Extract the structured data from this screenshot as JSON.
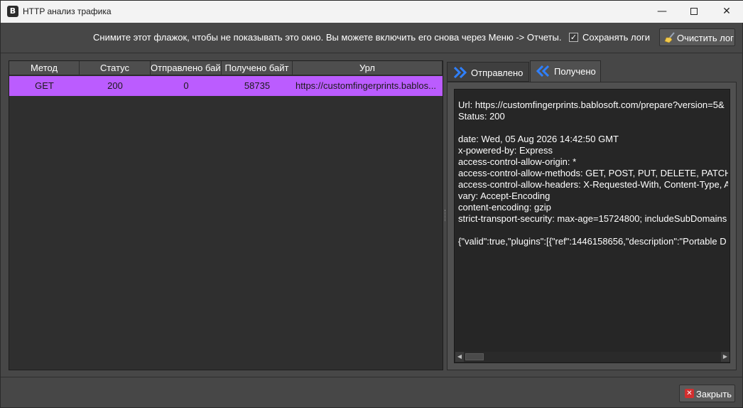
{
  "window": {
    "title": "HTTP анализ трафика",
    "app_icon_letter": "B",
    "minimize_glyph": "—",
    "close_glyph": "✕"
  },
  "toolbar": {
    "info_text": "Снимите этот флажок, чтобы не показывать это окно. Вы можете включить его снова через Меню -> Отчеты.",
    "save_logs_checked": true,
    "save_logs_check_glyph": "✓",
    "save_logs_label": "Сохранять логи",
    "clear_log_label": "Очистить лог",
    "clear_log_icon": "broom-icon"
  },
  "table": {
    "columns": [
      "Метод",
      "Статус",
      "Отправлено байт",
      "Получено байт",
      "Урл"
    ],
    "rows": [
      {
        "method": "GET",
        "status": "200",
        "sent": "0",
        "received": "58735",
        "url": "https://customfingerprints.bablos..."
      }
    ],
    "selected_row_color": "#bb5cff"
  },
  "tabs": {
    "sent_label": "Отправлено",
    "received_label": "Получено",
    "active": "received",
    "accent_color": "#2f80ff"
  },
  "response": {
    "text": "Url: https://customfingerprints.bablosoft.com/prepare?version=5&\nStatus: 200\n\ndate: Wed, 05 Aug 2026 14:42:50 GMT\nx-powered-by: Express\naccess-control-allow-origin: *\naccess-control-allow-methods: GET, POST, PUT, DELETE, PATCH, O\naccess-control-allow-headers: X-Requested-With, Content-Type, A\nvary: Accept-Encoding\ncontent-encoding: gzip\nstrict-transport-security: max-age=15724800; includeSubDomains\n\n{\"valid\":true,\"plugins\":[{\"ref\":1446158656,\"description\":\"Portable D"
  },
  "footer": {
    "close_label": "Закрыть",
    "close_glyph": "✕"
  }
}
